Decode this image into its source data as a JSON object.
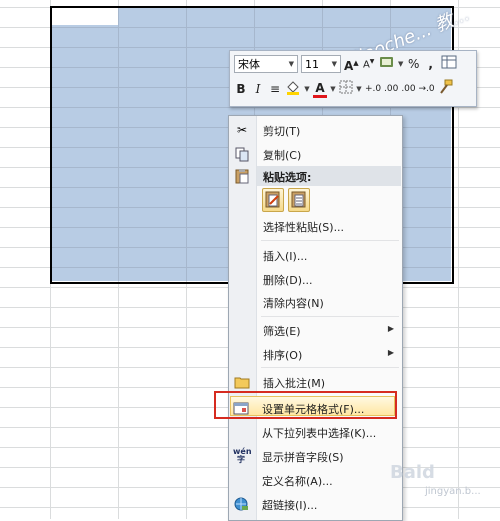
{
  "watermark_top": "jiaoche... 教...",
  "watermark_bottom": "Baid",
  "watermark_bottom_sub": "jingyan.b...",
  "toolbar": {
    "font_name": "宋体",
    "font_size": "11",
    "grow_font": "A",
    "shrink_font": "A",
    "percent": "%",
    "comma": ",",
    "bold": "B",
    "italic": "I",
    "font_color_letter": "A",
    "increase_decimal": "+.0 .00",
    "decrease_decimal": ".00 →.0"
  },
  "menu": {
    "cut": "剪切(T)",
    "copy": "复制(C)",
    "paste_options": "粘贴选项:",
    "paste_special": "选择性粘贴(S)...",
    "insert": "插入(I)...",
    "delete": "删除(D)...",
    "clear_contents": "清除内容(N)",
    "filter": "筛选(E)",
    "sort": "排序(O)",
    "insert_comment": "插入批注(M)",
    "format_cells": "设置单元格格式(F)...",
    "pick_from_list": "从下拉列表中选择(K)...",
    "show_phonetic": "显示拼音字段(S)",
    "define_name": "定义名称(A)...",
    "hyperlink": "超链接(I)...",
    "phonetic_icon_text": "wén"
  },
  "colors": {
    "selection": "#b8cce4",
    "highlight_border": "#d62b20",
    "menu_background": "#fafafa"
  }
}
